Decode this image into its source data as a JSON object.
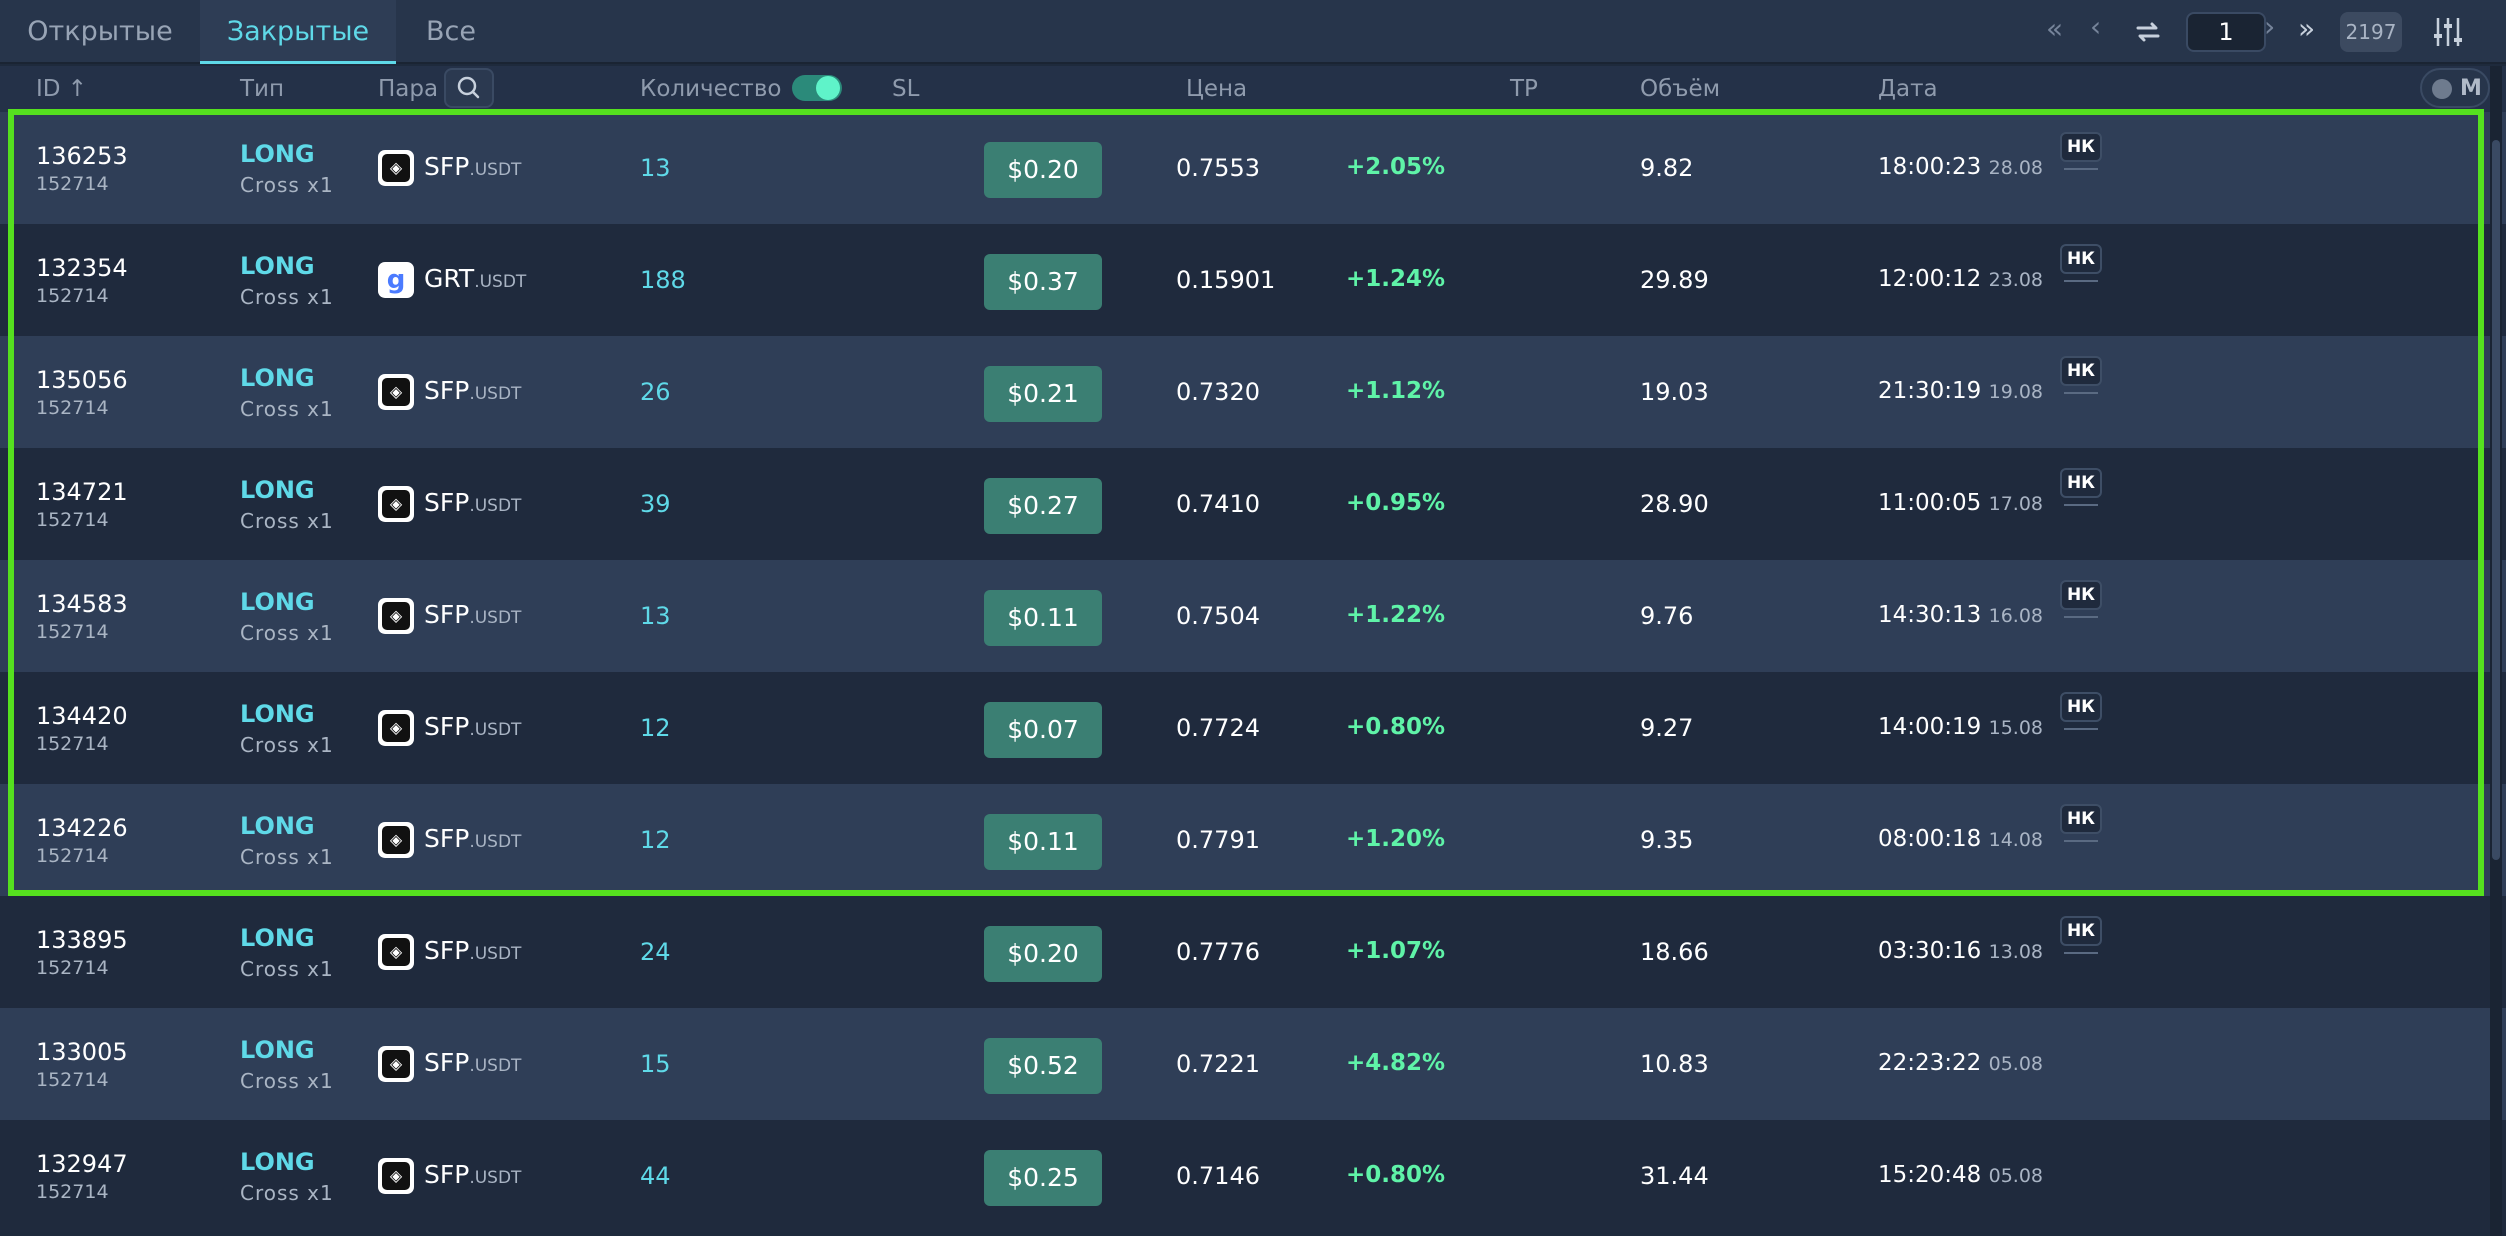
{
  "tabs": [
    {
      "label": "Открытые",
      "active": false
    },
    {
      "label": "Закрытые",
      "active": true
    },
    {
      "label": "Все",
      "active": false
    }
  ],
  "pagination": {
    "current_page": "1",
    "total": "2197"
  },
  "columns": {
    "id": "ID ↑",
    "type": "Тип",
    "pair": "Пара",
    "quantity": "Количество",
    "sl": "SL",
    "price": "Цена",
    "tp": "TP",
    "volume": "Объём",
    "date": "Дата"
  },
  "mode_toggle_label": "M",
  "colors": {
    "accent": "#5fd9e8",
    "positive": "#5ff3a8",
    "sl_button": "#3b7f73",
    "highlight": "#55e01f"
  },
  "rows": [
    {
      "id": "136253",
      "sub_id": "152714",
      "side": "LONG",
      "margin": "Cross x1",
      "coin": "SFP",
      "quote": ".USDT",
      "icon": "sfp",
      "qty": "13",
      "sl": "$0.20",
      "price": "0.7553",
      "pct": "+2.05%",
      "volume": "9.82",
      "time": "18:00:23",
      "date": "28.08",
      "badge": "НК"
    },
    {
      "id": "132354",
      "sub_id": "152714",
      "side": "LONG",
      "margin": "Cross x1",
      "coin": "GRT",
      "quote": ".USDT",
      "icon": "grt",
      "qty": "188",
      "sl": "$0.37",
      "price": "0.15901",
      "pct": "+1.24%",
      "volume": "29.89",
      "time": "12:00:12",
      "date": "23.08",
      "badge": "НК"
    },
    {
      "id": "135056",
      "sub_id": "152714",
      "side": "LONG",
      "margin": "Cross x1",
      "coin": "SFP",
      "quote": ".USDT",
      "icon": "sfp",
      "qty": "26",
      "sl": "$0.21",
      "price": "0.7320",
      "pct": "+1.12%",
      "volume": "19.03",
      "time": "21:30:19",
      "date": "19.08",
      "badge": "НК"
    },
    {
      "id": "134721",
      "sub_id": "152714",
      "side": "LONG",
      "margin": "Cross x1",
      "coin": "SFP",
      "quote": ".USDT",
      "icon": "sfp",
      "qty": "39",
      "sl": "$0.27",
      "price": "0.7410",
      "pct": "+0.95%",
      "volume": "28.90",
      "time": "11:00:05",
      "date": "17.08",
      "badge": "НК"
    },
    {
      "id": "134583",
      "sub_id": "152714",
      "side": "LONG",
      "margin": "Cross x1",
      "coin": "SFP",
      "quote": ".USDT",
      "icon": "sfp",
      "qty": "13",
      "sl": "$0.11",
      "price": "0.7504",
      "pct": "+1.22%",
      "volume": "9.76",
      "time": "14:30:13",
      "date": "16.08",
      "badge": "НК"
    },
    {
      "id": "134420",
      "sub_id": "152714",
      "side": "LONG",
      "margin": "Cross x1",
      "coin": "SFP",
      "quote": ".USDT",
      "icon": "sfp",
      "qty": "12",
      "sl": "$0.07",
      "price": "0.7724",
      "pct": "+0.80%",
      "volume": "9.27",
      "time": "14:00:19",
      "date": "15.08",
      "badge": "НК"
    },
    {
      "id": "134226",
      "sub_id": "152714",
      "side": "LONG",
      "margin": "Cross x1",
      "coin": "SFP",
      "quote": ".USDT",
      "icon": "sfp",
      "qty": "12",
      "sl": "$0.11",
      "price": "0.7791",
      "pct": "+1.20%",
      "volume": "9.35",
      "time": "08:00:18",
      "date": "14.08",
      "badge": "НК"
    },
    {
      "id": "133895",
      "sub_id": "152714",
      "side": "LONG",
      "margin": "Cross x1",
      "coin": "SFP",
      "quote": ".USDT",
      "icon": "sfp",
      "qty": "24",
      "sl": "$0.20",
      "price": "0.7776",
      "pct": "+1.07%",
      "volume": "18.66",
      "time": "03:30:16",
      "date": "13.08",
      "badge": "НК"
    },
    {
      "id": "133005",
      "sub_id": "152714",
      "side": "LONG",
      "margin": "Cross x1",
      "coin": "SFP",
      "quote": ".USDT",
      "icon": "sfp",
      "qty": "15",
      "sl": "$0.52",
      "price": "0.7221",
      "pct": "+4.82%",
      "volume": "10.83",
      "time": "22:23:22",
      "date": "05.08",
      "badge": ""
    },
    {
      "id": "132947",
      "sub_id": "152714",
      "side": "LONG",
      "margin": "Cross x1",
      "coin": "SFP",
      "quote": ".USDT",
      "icon": "sfp",
      "qty": "44",
      "sl": "$0.25",
      "price": "0.7146",
      "pct": "+0.80%",
      "volume": "31.44",
      "time": "15:20:48",
      "date": "05.08",
      "badge": ""
    }
  ]
}
